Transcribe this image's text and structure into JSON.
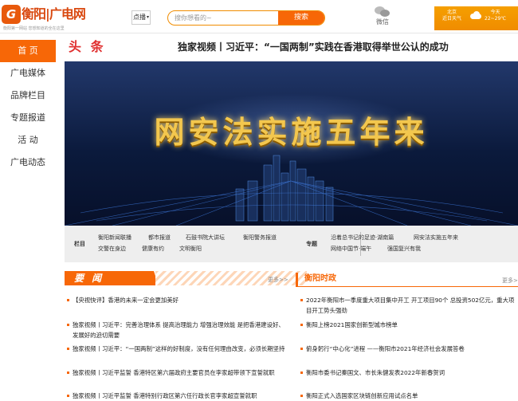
{
  "header": {
    "logo_mark": "G",
    "logo_name": "衡阳|广电网",
    "logo_slogan": "衡阳第一网站 您想知道的全在这里",
    "search_select": "点播",
    "search_placeholder": "搜你想看的~",
    "search_button": "搜索",
    "wechat_label": "微信",
    "weather": {
      "city": "北京",
      "today_label": "今天",
      "live_label": "近日天气",
      "temp": "22~29℃"
    }
  },
  "sidebar": {
    "items": [
      "首 页",
      "广电媒体",
      "品牌栏目",
      "专题报道",
      "活 动",
      "广电动态"
    ]
  },
  "headline": {
    "label": "头 条",
    "title": "独家视频丨习近平：“一国两制”实践在香港取得举世公认的成功"
  },
  "banner": {
    "text": "网安法实施五年来"
  },
  "channels": {
    "label_left": "栏目",
    "left": [
      "衡阳新闻联播",
      "都市报道",
      "石鼓书院大讲坛",
      "衡阳警务报道",
      "交警在身边",
      "健康有约",
      "文明衡阳"
    ],
    "label_right": "专题",
    "right": [
      "沿着总书记的足迹·湖南篇",
      "网安法实施五年来",
      "网络中国节·端午",
      "强国复兴有我"
    ]
  },
  "news_left": {
    "title": "要 闻",
    "more": "更多>>",
    "items": [
      "【央视快评】香港的未来一定会更加美好",
      "独家视频丨习近平：完善治理体系 提高治理能力 增强治理效能 是把香港建设好、发展好的迫切需要",
      "独家视频丨习近平：“一国两制”这样的好制度，没有任何理由改变，必须长期坚持",
      "独家视频丨习近平监誓 香港特区第六届政府主要官员在李家超带领下宣誓就职",
      "独家视频丨习近平监誓 香港特别行政区第六任行政长官李家超宣誓就职"
    ]
  },
  "news_right": {
    "title": "衡阳时政",
    "more": "更多>",
    "items": [
      "2022年衡阳市一季度重大项目集中开工 开工项目90个 总投资502亿元，重大项目开工势头强劲",
      "衡阳上榜2021国家创新型城市榜单",
      "俯身躬行“中心化”进程 ——衡阳市2021年经济社会发展答卷",
      "衡阳市委书记秦国文、市长朱健发表2022年新春贺词",
      "衡阳正式入选国家区块链创新应用试点名单"
    ]
  }
}
